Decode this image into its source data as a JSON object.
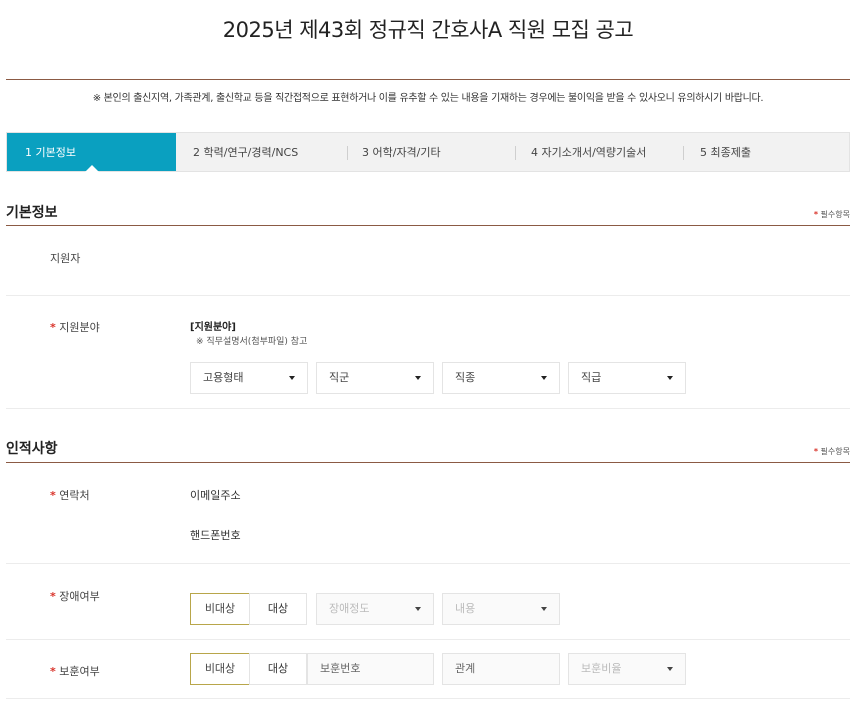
{
  "header": {
    "title": "2025년 제43회 정규직 간호사A 직원 모집 공고",
    "notice": "※ 본인의 출신지역, 가족관계, 출신학교 등을 직간접적으로 표현하거나 이를 유추할 수 있는 내용을 기재하는 경우에는 불이익을 받을 수 있사오니 유의하시기 바랍니다."
  },
  "steps": [
    {
      "label": "1 기본정보",
      "active": true
    },
    {
      "label": "2 학력/연구/경력/NCS",
      "active": false
    },
    {
      "label": "3 어학/자격/기타",
      "active": false
    },
    {
      "label": "4 자기소개서/역량기술서",
      "active": false
    },
    {
      "label": "5 최종제출",
      "active": false
    }
  ],
  "required_mark": "*",
  "required_note": "필수항목",
  "basic": {
    "title": "기본정보",
    "applicant_label": "지원자",
    "field_label": "지원분야",
    "field_heading": "[지원분야]",
    "field_note": "※ 직무설명서(첨부파일) 참고",
    "selects": [
      "고용형태",
      "직군",
      "직종",
      "직급"
    ]
  },
  "personal": {
    "title": "인적사항",
    "contact_label": "연락처",
    "email_label": "이메일주소",
    "phone_label": "핸드폰번호",
    "disability": {
      "label": "장애여부",
      "toggle_off": "비대상",
      "toggle_on": "대상",
      "grade_placeholder": "장애정도",
      "type_placeholder": "내용"
    },
    "veteran": {
      "label": "보훈여부",
      "toggle_off": "비대상",
      "toggle_on": "대상",
      "number_placeholder": "보훈번호",
      "relation_placeholder": "관계",
      "ratio_placeholder": "보훈비율"
    }
  }
}
